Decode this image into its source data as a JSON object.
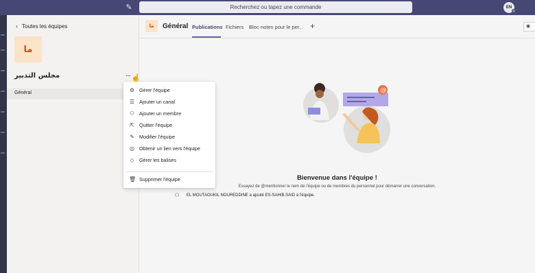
{
  "topbar": {
    "search_placeholder": "Recherchez ou tapez une commande",
    "avatar_initials": "EN",
    "compose_icon": "compose-icon",
    "accent": "#464775"
  },
  "sidebar": {
    "back_label": "Toutes les équipes",
    "team_tile_text": "ما",
    "team_tile_color": "#fbe3c7",
    "team_name": "مجلس التدبير",
    "more_icon": "ellipsis-icon",
    "channels": [
      {
        "label": "Général"
      }
    ]
  },
  "menu": {
    "items": [
      {
        "label": "Gérer l'équipe",
        "icon": "gear-icon"
      },
      {
        "label": "Ajouter un canal",
        "icon": "add-channel-icon"
      },
      {
        "label": "Ajouter un membre",
        "icon": "add-member-icon"
      },
      {
        "label": "Quitter l'équipe",
        "icon": "leave-icon"
      },
      {
        "label": "Modifier l'équipe",
        "icon": "pencil-icon"
      },
      {
        "label": "Obtenir un lien vers l'équipe",
        "icon": "link-icon"
      },
      {
        "label": "Gérer les balises",
        "icon": "tag-icon"
      },
      {
        "label": "Supprimer l'équipe",
        "icon": "trash-icon"
      }
    ]
  },
  "main": {
    "channel_icon_text": "ما",
    "channel_title": "Général",
    "tabs": [
      {
        "label": "Publications",
        "active": true
      },
      {
        "label": "Fichiers",
        "active": false
      },
      {
        "label": "Bloc-notes pour le per...",
        "active": false
      }
    ],
    "welcome_title": "Bienvenue dans l'équipe !",
    "welcome_subtitle": "Essayez de @mentionner le nom de l'équipe ou de membres du personnel pour démarrer une conversation.",
    "activity_text": "EL MOUTAOUKIL NOUREDDINE a ajouté ES-SAHIB.SAID à l'équipe.",
    "tab_accent": "#6264a7"
  }
}
